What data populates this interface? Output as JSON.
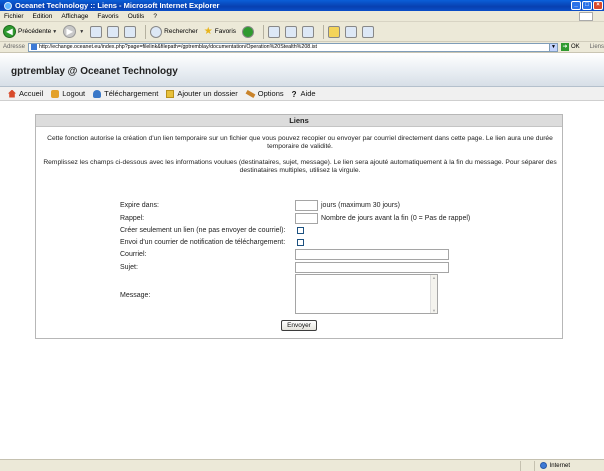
{
  "window": {
    "title": "Oceanet Technology :: Liens - Microsoft Internet Explorer",
    "minimize": "_",
    "maximize": "□",
    "close": "×"
  },
  "menu": [
    "Fichier",
    "Edition",
    "Affichage",
    "Favoris",
    "Outils",
    "?"
  ],
  "toolbar": {
    "back_label": "Précédente",
    "search_label": "Rechercher",
    "favorites_label": "Favoris"
  },
  "address": {
    "label": "Adresse",
    "url": "http://echange.oceanet.eu/index.php?page=filelink&filepath=/gptremblay/documentation/Operation%20Stealth%208.ist",
    "go_label": "OK",
    "links_label": "Liens"
  },
  "site": {
    "title": "gptremblay @ Oceanet Technology"
  },
  "nav": [
    {
      "label": "Accueil",
      "icon": "home-icon"
    },
    {
      "label": "Logout",
      "icon": "logout-icon"
    },
    {
      "label": "Téléchargement",
      "icon": "download-icon"
    },
    {
      "label": "Ajouter un dossier",
      "icon": "folder-icon"
    },
    {
      "label": "Options",
      "icon": "options-icon"
    },
    {
      "label": "Aide",
      "icon": "help-icon"
    }
  ],
  "panel": {
    "title": "Liens",
    "intro1": "Cette fonction autorise la création d'un lien temporaire sur un fichier que vous pouvez recopier ou envoyer par courriel directement dans cette page. Le lien aura une durée temporaire de validité.",
    "intro2": "Remplissez les champs ci-dessous avec les informations voulues (destinataires, sujet, message). Le lien sera ajouté automatiquement à la fin du message. Pour séparer des destinataires multiples, utilisez la virgule."
  },
  "form": {
    "expire_label": "Expire dans:",
    "expire_value": "",
    "expire_hint": "jours (maximum 30 jours)",
    "rappel_label": "Rappel:",
    "rappel_value": "",
    "rappel_hint": "Nombre de jours avant la fin (0 = Pas de rappel)",
    "link_only_label": "Créer seulement un lien (ne pas envoyer de courriel):",
    "link_only_checked": false,
    "notify_label": "Envoi d'un courrier de notification de téléchargement:",
    "notify_checked": false,
    "email_label": "Courriel:",
    "email_value": "",
    "subject_label": "Sujet:",
    "subject_value": "",
    "message_label": "Message:",
    "message_value": "",
    "send_button": "Envoyer"
  },
  "status": {
    "zone": "Internet"
  }
}
